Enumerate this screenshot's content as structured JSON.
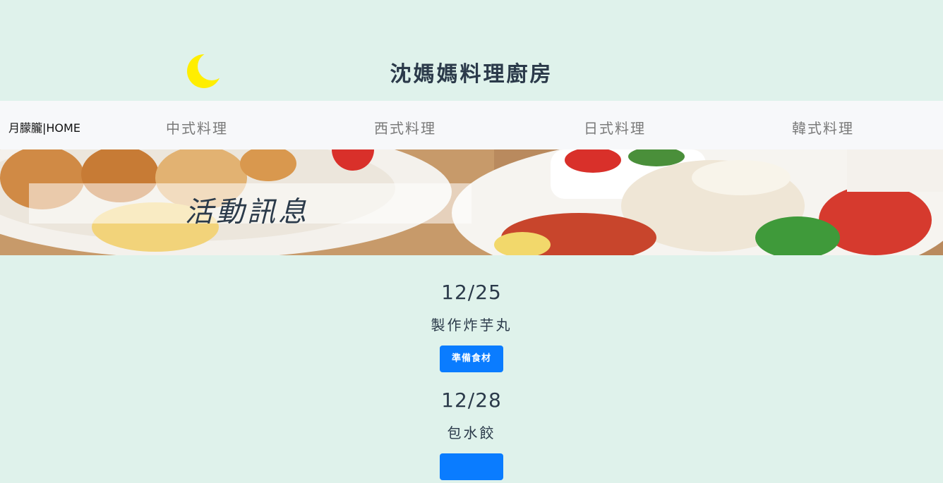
{
  "header": {
    "site_title": "沈媽媽料理廚房"
  },
  "navbar": {
    "brand": "月朦朧|HOME",
    "items": [
      {
        "label": "中式料理"
      },
      {
        "label": "西式料理"
      },
      {
        "label": "日式料理"
      },
      {
        "label": "韓式料理"
      }
    ]
  },
  "banner": {
    "title": "活動訊息"
  },
  "events": [
    {
      "date": "12/25",
      "name": "製作炸芋丸",
      "button": "準備食材"
    },
    {
      "date": "12/28",
      "name": "包水餃",
      "button": ""
    }
  ],
  "colors": {
    "background": "#dff2eb",
    "navbar": "#f7f8fa",
    "accent": "#0a7cff",
    "moon": "#ffee00"
  },
  "icons": {
    "moon": "crescent-moon-icon"
  }
}
